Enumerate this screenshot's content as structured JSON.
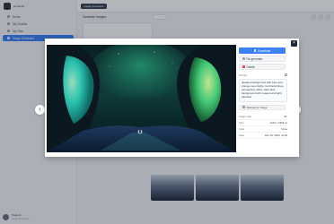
{
  "app": {
    "name": "AI Studio",
    "tab_label": "Image Generator"
  },
  "sidebar": {
    "items": [
      {
        "label": "Home"
      },
      {
        "label": "My Chatbot"
      },
      {
        "label": "My Files"
      },
      {
        "label": "Image Generator"
      }
    ],
    "section_label": "",
    "user": {
      "name": "Student",
      "email": "student@mail.com"
    }
  },
  "content": {
    "heading": "Generate Images",
    "prompt_label": "Prompt"
  },
  "modal": {
    "close_label": "×",
    "prev_label": "‹",
    "next_label": "›",
    "download_label": "Download",
    "favorite_label": "Re-generate",
    "delete_label": "Delete",
    "prompt_heading": "Prompt",
    "prompt_text": "detailed background with blue and orange neon lights, horizontal lines, perspective effect, dark blue background with neatest and light particles",
    "reference_label": "Reference Image",
    "meta": [
      {
        "key": "Image ratio",
        "value": "16:"
      },
      {
        "key": "Size",
        "value": "1344 × 2304 px"
      },
      {
        "key": "Style",
        "value": "None"
      },
      {
        "key": "Date",
        "value": "Dec 19, 2024, 11:00"
      }
    ]
  },
  "colors": {
    "accent": "#3b82f6",
    "dark": "#1f2937",
    "aurora": "#34d399"
  },
  "icons": {
    "close": "close-icon",
    "prev": "chevron-left-icon",
    "next": "chevron-right-icon",
    "download": "download-icon",
    "regenerate": "refresh-icon",
    "delete": "trash-icon",
    "copy": "copy-icon"
  }
}
